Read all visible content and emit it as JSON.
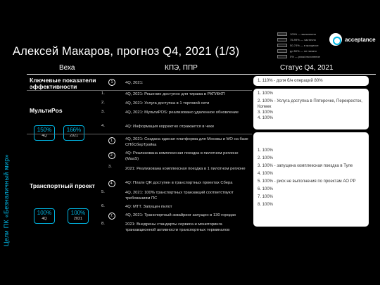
{
  "legend": [
    {
      "text": "100% — выполнено"
    },
    {
      "text": "75-99% — частично"
    },
    {
      "text": "50-74% — в процессе"
    },
    {
      "text": "до 50% — не начато"
    },
    {
      "text": "0% — риск/отклонение"
    }
  ],
  "logo": {
    "name": "acceptance"
  },
  "title": "Алексей Макаров, прогноз Q4, 2021 (1/3)",
  "columns": {
    "milestones": "Веха",
    "kpi": "КПЭ, ППР",
    "status": "Статус Q4, 2021"
  },
  "vertical_label": "Цели ПК «Безналичный мир»",
  "kpi_section": {
    "label": "Ключевые показатели эффективности",
    "item_num": "1",
    "item_text": "4Q, 2021:",
    "status": "1.    110% - доля б/н операций 80%"
  },
  "multipos": {
    "label": "МультиPos",
    "metrics": [
      {
        "pct": "150%",
        "period": "4Q"
      },
      {
        "pct": "166%",
        "period": "2021"
      }
    ],
    "items": [
      {
        "num": "1.",
        "text": "4Q, 2021: Решение доступно для тиража в РКП/ФКП"
      },
      {
        "num": "2.",
        "num_text": "",
        "text": "4Q, 2021: Услуга доступна в 1 торговой сети"
      },
      {
        "num": "3.",
        "text": "4Q, 2021: МультиPOS: реализовано удаленное обновление"
      },
      {
        "num": "4.",
        "text": "4Q: Информация корректно отражается в чеке"
      }
    ],
    "status": [
      "1.    100%",
      "2.    100% - Услуга доступна в Пятерочке, Перекресток, Копеек",
      "3.    100%",
      "4.    100%"
    ]
  },
  "transport": {
    "label": "Транспортный проект",
    "metrics": [
      {
        "pct": "100%",
        "period": "4Q"
      },
      {
        "pct": "100%",
        "period": "2021"
      }
    ],
    "items": [
      {
        "num": "1.",
        "text": "4Q, 2021: Создана единая платформа для Москвы и МО на базе СПбСберТройка"
      },
      {
        "num": "2.",
        "text": "4Q: Реализована комплексная поездка в пилотном регионе (MaaS)"
      },
      {
        "num": "3.",
        "text": "2021: Реализована комплексная поездка в 1 пилотном регионе"
      },
      {
        "num": "4.",
        "text": "4Q: Плати QR доступен в транспортных проектах Сбера"
      },
      {
        "num": "5.",
        "text": "4Q, 2021: 100% транспортных транзакций соответствуют требованиям ПС"
      },
      {
        "num": "6.",
        "text": "4Q: МТТ. Запущен пилот"
      },
      {
        "num": "7.",
        "text": "4Q, 2021: Транспортный эквайринг запущен в 130 городах"
      },
      {
        "num": "8.",
        "text": "2021: Внедрены стандарты сервиса и мониторинга транзакционной активности транспортных терминалов"
      }
    ],
    "status": [
      "1.    100%",
      "2.    100%",
      "3.    100% - запущена комплексная поездка в Туле",
      "4.    100%",
      "5.    100% - риск не выполнения по проектам АО РР",
      "6.    100%",
      "7.    100%",
      "8.    100%"
    ]
  },
  "colors": {
    "accent": "#00b5e2",
    "background": "#000000",
    "status_bg": "#ffffff"
  }
}
